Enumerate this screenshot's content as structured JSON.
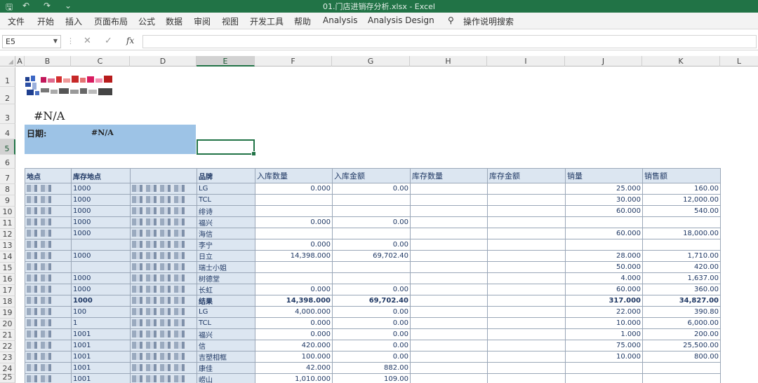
{
  "window": {
    "title": "01.门店进销存分析.xlsx - Excel",
    "quick_access": [
      "save-icon",
      "undo-icon",
      "redo-icon",
      "customize-icon"
    ]
  },
  "ribbon": {
    "tabs": [
      "文件",
      "开始",
      "插入",
      "页面布局",
      "公式",
      "数据",
      "审阅",
      "视图",
      "开发工具",
      "帮助",
      "Analysis",
      "Analysis Design"
    ],
    "tell_me": "操作说明搜索"
  },
  "formula_bar": {
    "name_box": "E5",
    "fx": "fx",
    "formula": ""
  },
  "columns": [
    "A",
    "B",
    "C",
    "D",
    "E",
    "F",
    "G",
    "H",
    "I",
    "J",
    "K",
    "L"
  ],
  "selected_column": "E",
  "rows": [
    "1",
    "2",
    "3",
    "4",
    "5",
    "6",
    "7",
    "8",
    "9",
    "10",
    "11",
    "12",
    "13",
    "14",
    "15",
    "16",
    "17",
    "18",
    "19",
    "20",
    "21",
    "22",
    "23",
    "24",
    "25"
  ],
  "selected_row": "5",
  "sheet": {
    "c3_value": "#N/A",
    "date_label": "日期:",
    "date_value": "#N/A"
  },
  "table": {
    "headers": [
      "地点",
      "库存地点",
      "",
      "品牌",
      "入库数量",
      "入库金额",
      "库存数量",
      "库存金额",
      "销量",
      "销售额"
    ],
    "rows": [
      {
        "loc": "1000",
        "brand": "LG",
        "in_qty": "0.000",
        "in_amt": "0.00",
        "stk_qty": "",
        "stk_amt": "",
        "sales_qty": "25.000",
        "sales_amt": "160.00"
      },
      {
        "loc": "1000",
        "brand": "TCL",
        "in_qty": "",
        "in_amt": "",
        "stk_qty": "",
        "stk_amt": "",
        "sales_qty": "30.000",
        "sales_amt": "12,000.00"
      },
      {
        "loc": "1000",
        "brand": "绯诗",
        "in_qty": "",
        "in_amt": "",
        "stk_qty": "",
        "stk_amt": "",
        "sales_qty": "60.000",
        "sales_amt": "540.00"
      },
      {
        "loc": "1000",
        "brand": "福兴",
        "in_qty": "0.000",
        "in_amt": "0.00",
        "stk_qty": "",
        "stk_amt": "",
        "sales_qty": "",
        "sales_amt": ""
      },
      {
        "loc": "1000",
        "brand": "海信",
        "in_qty": "",
        "in_amt": "",
        "stk_qty": "",
        "stk_amt": "",
        "sales_qty": "60.000",
        "sales_amt": "18,000.00"
      },
      {
        "loc": "",
        "brand": "李宁",
        "in_qty": "0.000",
        "in_amt": "0.00",
        "stk_qty": "",
        "stk_amt": "",
        "sales_qty": "",
        "sales_amt": ""
      },
      {
        "loc": "1000",
        "brand": "日立",
        "in_qty": "14,398.000",
        "in_amt": "69,702.40",
        "stk_qty": "",
        "stk_amt": "",
        "sales_qty": "28.000",
        "sales_amt": "1,710.00"
      },
      {
        "loc": "",
        "brand": "瑞士小姐",
        "in_qty": "",
        "in_amt": "",
        "stk_qty": "",
        "stk_amt": "",
        "sales_qty": "50.000",
        "sales_amt": "420.00"
      },
      {
        "loc": "1000",
        "brand": "树德堂",
        "in_qty": "",
        "in_amt": "",
        "stk_qty": "",
        "stk_amt": "",
        "sales_qty": "4.000",
        "sales_amt": "1,637.00"
      },
      {
        "loc": "1000",
        "brand": "长虹",
        "in_qty": "0.000",
        "in_amt": "0.00",
        "stk_qty": "",
        "stk_amt": "",
        "sales_qty": "60.000",
        "sales_amt": "360.00"
      },
      {
        "loc": "1000",
        "brand": "结果",
        "in_qty": "14,398.000",
        "in_amt": "69,702.40",
        "stk_qty": "",
        "stk_amt": "",
        "sales_qty": "317.000",
        "sales_amt": "34,827.00",
        "total": true
      },
      {
        "loc": "100",
        "brand": "LG",
        "in_qty": "4,000.000",
        "in_amt": "0.00",
        "stk_qty": "",
        "stk_amt": "",
        "sales_qty": "22.000",
        "sales_amt": "390.80"
      },
      {
        "loc": "1",
        "brand": "TCL",
        "in_qty": "0.000",
        "in_amt": "0.00",
        "stk_qty": "",
        "stk_amt": "",
        "sales_qty": "10.000",
        "sales_amt": "6,000.00"
      },
      {
        "loc": "1001",
        "brand": "福兴",
        "in_qty": "0.000",
        "in_amt": "0.00",
        "stk_qty": "",
        "stk_amt": "",
        "sales_qty": "1.000",
        "sales_amt": "200.00"
      },
      {
        "loc": "1001",
        "brand": "信",
        "in_qty": "420.000",
        "in_amt": "0.00",
        "stk_qty": "",
        "stk_amt": "",
        "sales_qty": "75.000",
        "sales_amt": "25,500.00"
      },
      {
        "loc": "1001",
        "brand": "吉塑相框",
        "in_qty": "100.000",
        "in_amt": "0.00",
        "stk_qty": "",
        "stk_amt": "",
        "sales_qty": "10.000",
        "sales_amt": "800.00"
      },
      {
        "loc": "1001",
        "brand": "康佳",
        "in_qty": "42.000",
        "in_amt": "882.00",
        "stk_qty": "",
        "stk_amt": "",
        "sales_qty": "",
        "sales_amt": ""
      },
      {
        "loc": "1001",
        "brand": "崂山",
        "in_qty": "1,010.000",
        "in_amt": "109.00",
        "stk_qty": "",
        "stk_amt": "",
        "sales_qty": "",
        "sales_amt": ""
      }
    ]
  },
  "colors": {
    "excel_green": "#217346",
    "header_blue": "#dce6f1",
    "date_block": "#9dc3e6"
  }
}
